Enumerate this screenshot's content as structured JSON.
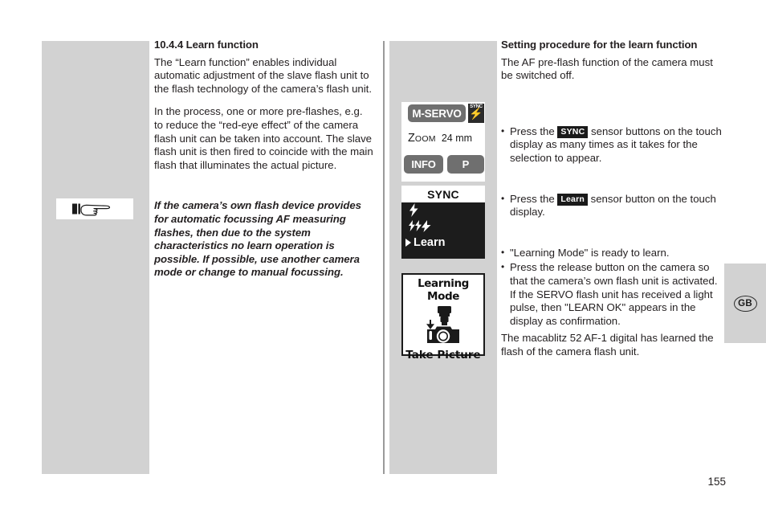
{
  "page": {
    "number": "155",
    "language_tab": "GB"
  },
  "left_column": {
    "heading": "10.4.4 Learn function",
    "paragraphs": [
      "The “Learn function” enables individual automatic adjustment of the slave flash unit to the flash technology of the camera’s flash unit.",
      "In the process, one or more pre-flashes, e.g. to reduce the “red-eye effect” of the camera flash unit can be taken into account. The slave flash unit is then fired to coincide with the main flash that illuminates the actual picture."
    ],
    "note": "If the camera’s own flash device provides for automatic focussing AF measuring flashes, then due to the system characteristics no learn operation is possible. If possible, use another camera mode or change to manual focussing.",
    "note_icon": "pointing-hand-icon"
  },
  "display_status": {
    "mode_label": "M-SERVO",
    "sync_badge_label": "SYNC",
    "sync_badge_icon": "flash-bolt-icon",
    "zoom_label_first": "Z",
    "zoom_label_rest": "OOM",
    "zoom_value": "24 mm",
    "info_label": "INFO",
    "program_label": "P"
  },
  "display_sync": {
    "title": "SYNC",
    "items": [
      {
        "label": "",
        "icon": "single-flash-icon",
        "selected": false
      },
      {
        "label": "",
        "icon": "multi-flash-icon",
        "selected": false
      },
      {
        "label": "Learn",
        "icon": "caret-right-icon",
        "selected": true
      }
    ]
  },
  "display_learn": {
    "title": "Learning Mode",
    "icon": "camera-with-flash-icon",
    "footer": "Take Picture"
  },
  "right_column": {
    "heading": "Setting procedure for the learn function",
    "intro": "The AF pre-flash function of the camera must be switched off.",
    "bullets": [
      {
        "pre": "Press the ",
        "badge": "SYNC",
        "post": " sensor buttons on the touch display as many times as it takes for the selection to appear."
      },
      {
        "pre": "Press the ",
        "badge": "Learn",
        "post": " sensor button on the touch display."
      },
      {
        "pre": "\"Learning Mode\" is ready to learn.",
        "badge": "",
        "post": ""
      },
      {
        "pre": "Press the release button on the camera so that the camera’s own flash unit is activated.",
        "badge": "",
        "post": "If the SERVO flash unit has received a light pulse, then \"LEARN OK\" appears in the display as confirmation."
      }
    ],
    "closing": "The macablitz 52 AF-1 digital has learned the flash of the camera flash unit."
  },
  "colors": {
    "gray_panel": "#d2d2d2",
    "dark_badge": "#1a1a1a",
    "pill_gray": "#6f6f6f",
    "text": "#231f20"
  }
}
